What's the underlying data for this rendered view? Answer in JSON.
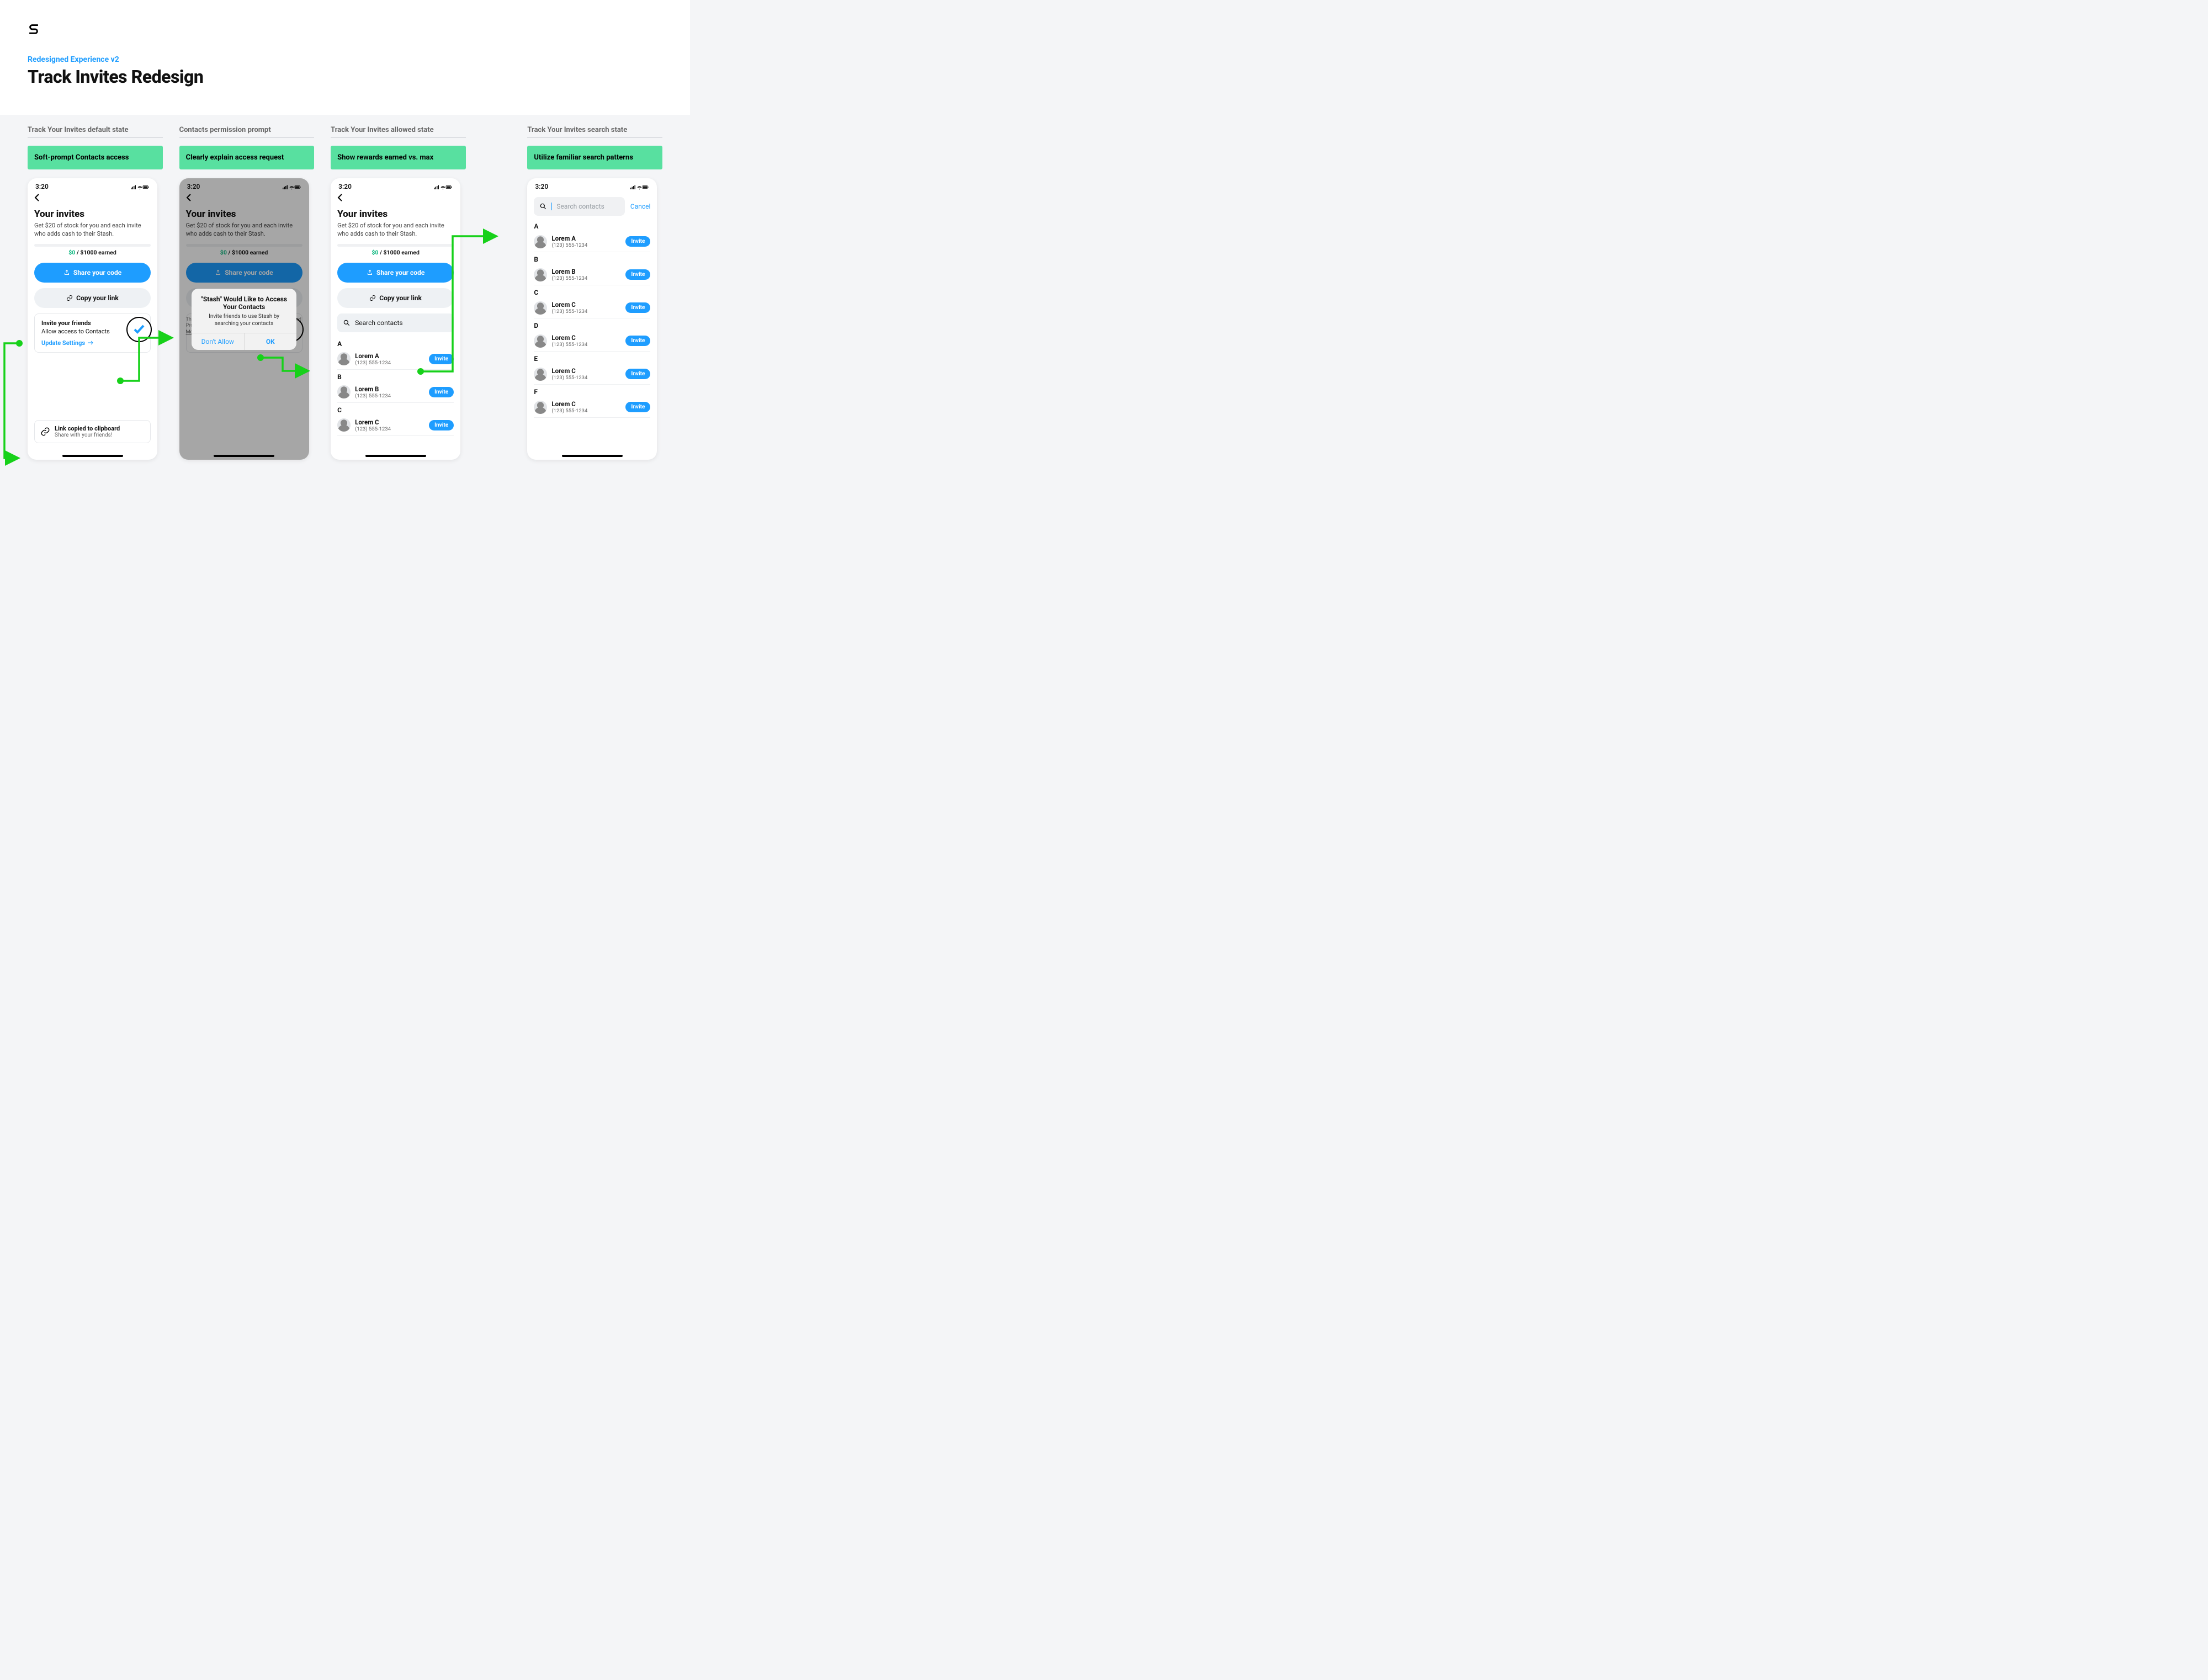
{
  "header": {
    "logo": "S",
    "eyebrow": "Redesigned Experience v2",
    "title": "Track Invites Redesign"
  },
  "columns": [
    {
      "label": "Track Your Invites default state",
      "banner": "Soft-prompt Contacts access"
    },
    {
      "label": "Contacts permission prompt",
      "banner": "Clearly explain access request"
    },
    {
      "label": "Track Your Invites allowed state",
      "banner": "Show rewards earned vs. max"
    },
    {
      "label": "Track Your Invites search state",
      "banner": "Utilize familiar search patterns"
    }
  ],
  "phone": {
    "time": "3:20",
    "back": "‹",
    "h1": "Your invites",
    "sub": "Get $20 of stock for you and each invite who adds cash to their Stash.",
    "earned_amt": "$0",
    "earned_rest": " / $1000 earned",
    "share_btn": "Share your code",
    "copy_btn": "Copy your link",
    "settings_card": {
      "title": "Invite your friends",
      "body": "Allow access to Contacts",
      "link": "Update Settings"
    },
    "toast": {
      "title": "Link copied to clipboard",
      "sub": "Share with your friends!"
    },
    "legal": "This Program Offer is subject to the Stash it Forward Program Solicitation Agreement and excludes… ",
    "legal_more": "More",
    "alert": {
      "title": "\"Stash\" Would Like to Access Your Contacts",
      "msg": "Invite friends to use Stash by searching your contacts",
      "deny": "Don't Allow",
      "ok": "OK"
    },
    "search_placeholder": "Search contacts",
    "cancel": "Cancel",
    "invite_pill": "Invite",
    "contacts3": [
      {
        "letter": "A",
        "name": "Lorem A",
        "phone": "(123) 555-1234"
      },
      {
        "letter": "B",
        "name": "Lorem B",
        "phone": "(123) 555-1234"
      },
      {
        "letter": "C",
        "name": "Lorem C",
        "phone": "(123) 555-1234"
      }
    ],
    "contacts4": [
      {
        "letter": "A",
        "name": "Lorem A",
        "phone": "(123) 555-1234"
      },
      {
        "letter": "B",
        "name": "Lorem B",
        "phone": "(123) 555-1234"
      },
      {
        "letter": "C",
        "name": "Lorem C",
        "phone": "(123) 555-1234"
      },
      {
        "letter": "D",
        "name": "Lorem C",
        "phone": "(123) 555-1234"
      },
      {
        "letter": "E",
        "name": "Lorem C",
        "phone": "(123) 555-1234"
      },
      {
        "letter": "F",
        "name": "Lorem C",
        "phone": "(123) 555-1234"
      }
    ]
  }
}
